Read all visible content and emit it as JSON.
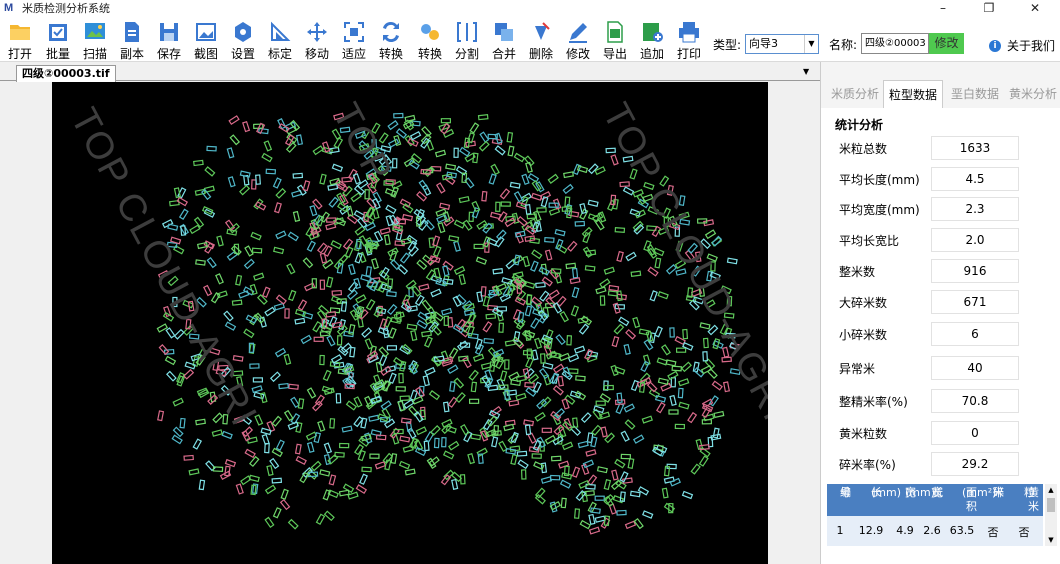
{
  "window": {
    "title": "米质检测分析系统",
    "logo": "M"
  },
  "toolbar": {
    "items": [
      {
        "label": "打开",
        "icon": "folder-icon"
      },
      {
        "label": "批量",
        "icon": "batch-icon"
      },
      {
        "label": "扫描",
        "icon": "scan-icon"
      },
      {
        "label": "副本",
        "icon": "copy-icon"
      },
      {
        "label": "保存",
        "icon": "save-icon"
      },
      {
        "label": "截图",
        "icon": "screenshot-icon"
      },
      {
        "label": "设置",
        "icon": "settings-icon"
      },
      {
        "label": "标定",
        "icon": "calibrate-icon"
      },
      {
        "label": "移动",
        "icon": "move-icon"
      },
      {
        "label": "适应",
        "icon": "fit-icon"
      },
      {
        "label": "转换",
        "icon": "convert-icon"
      },
      {
        "label": "转换",
        "icon": "convert2-icon"
      },
      {
        "label": "分割",
        "icon": "split-icon"
      },
      {
        "label": "合并",
        "icon": "merge-icon"
      },
      {
        "label": "删除",
        "icon": "delete-icon"
      },
      {
        "label": "修改",
        "icon": "edit-icon"
      },
      {
        "label": "导出",
        "icon": "export-icon"
      },
      {
        "label": "追加",
        "icon": "append-icon"
      },
      {
        "label": "打印",
        "icon": "print-icon"
      }
    ],
    "type_label": "类型:",
    "type_value": "向导3",
    "name_label": "名称:",
    "name_value": "四级②00003",
    "modify_button": "修改",
    "about": "关于我们"
  },
  "document": {
    "tab": "四级②00003.tif"
  },
  "watermarks": [
    "TOP CLOUD-AGRI",
    "TOP",
    "TOP CLOUD-AGRI"
  ],
  "panel": {
    "tabs": [
      "米质分析",
      "粒型数据",
      "垩白数据",
      "黄米分析"
    ],
    "active_tab": 1,
    "section_title": "统计分析",
    "stats": [
      {
        "label": "米粒总数",
        "value": "1633"
      },
      {
        "label": "平均长度(mm)",
        "value": "4.5"
      },
      {
        "label": "平均宽度(mm)",
        "value": "2.3"
      },
      {
        "label": "平均长宽比",
        "value": "2.0"
      },
      {
        "label": "整米数",
        "value": "916"
      },
      {
        "label": "大碎米数",
        "value": "671"
      },
      {
        "label": "小碎米数",
        "value": "6"
      },
      {
        "label": "异常米",
        "value": "40"
      },
      {
        "label": "整精米率(%)",
        "value": "70.8"
      },
      {
        "label": "黄米粒数",
        "value": "0"
      },
      {
        "label": "碎米率(%)",
        "value": "29.2"
      }
    ],
    "table": {
      "headers": [
        [
          "编",
          "号"
        ],
        [
          "长",
          "(mm)"
        ],
        [
          "宽",
          "(mm)"
        ],
        [
          "长",
          "宽"
        ],
        [
          "面积",
          "(mm²)"
        ],
        [
          "碎",
          "米"
        ],
        [
          "黄米",
          "粒"
        ]
      ],
      "rows": [
        [
          "1",
          "12.9",
          "4.9",
          "2.6",
          "63.5",
          "否",
          "否"
        ]
      ]
    }
  }
}
